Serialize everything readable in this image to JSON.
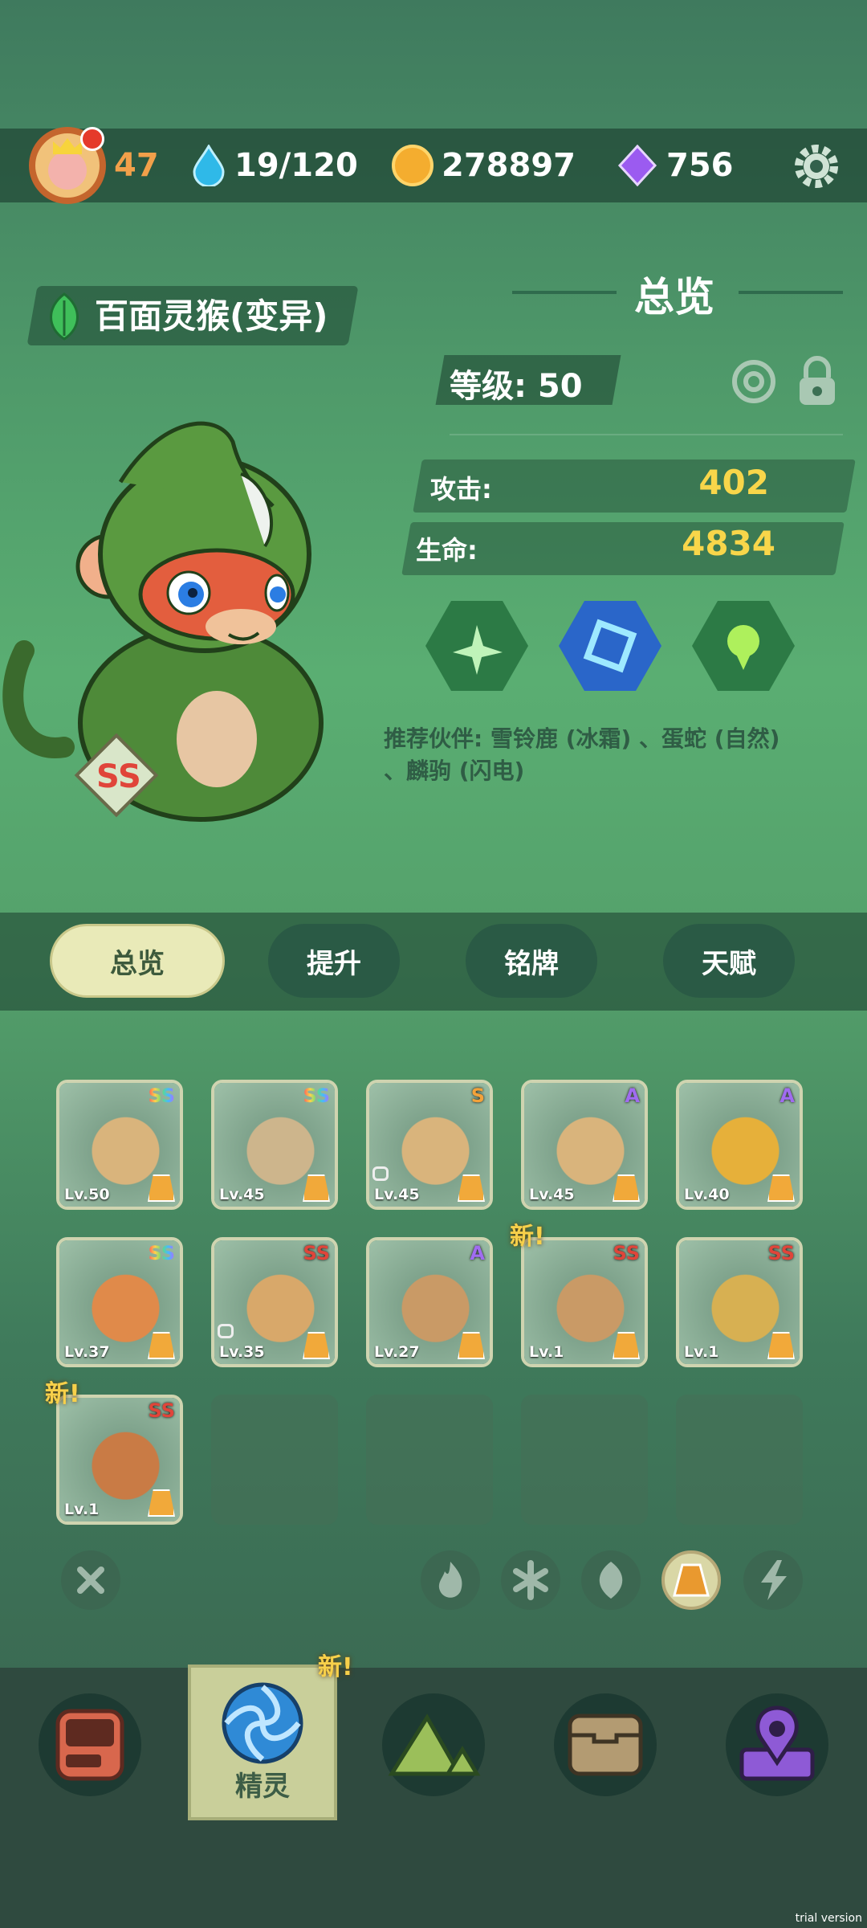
{
  "topbar": {
    "player_level": "47",
    "energy": "19/120",
    "coins": "278897",
    "gems": "756"
  },
  "pet": {
    "name": "百面灵猴(变异)",
    "rank": "SS",
    "level_label": "等级: 50",
    "attack_label": "攻击:",
    "attack_value": "402",
    "hp_label": "生命:",
    "hp_value": "4834",
    "recommend": "推荐伙伴: 雪铃鹿 (冰霜) 、蛋蛇 (自然) 、麟驹 (闪电)"
  },
  "panel_title": "总览",
  "tabs": [
    "总览",
    "提升",
    "铭牌",
    "天赋"
  ],
  "active_tab": 0,
  "roster": [
    {
      "level": "Lv.50",
      "rank": "SS",
      "rank_color": "rainbow",
      "locked": false,
      "new": false,
      "creature": "deer-spirit"
    },
    {
      "level": "Lv.45",
      "rank": "SS",
      "rank_color": "rainbow",
      "locked": false,
      "new": false,
      "creature": "antler-deer"
    },
    {
      "level": "Lv.45",
      "rank": "S",
      "rank_color": "#f3a23a",
      "locked": true,
      "new": false,
      "creature": "deer-spirit"
    },
    {
      "level": "Lv.45",
      "rank": "A",
      "rank_color": "#a06cf0",
      "locked": false,
      "new": false,
      "creature": "deer-spirit"
    },
    {
      "level": "Lv.40",
      "rank": "A",
      "rank_color": "#a06cf0",
      "locked": false,
      "new": false,
      "creature": "sunflower"
    },
    {
      "level": "Lv.37",
      "rank": "SS",
      "rank_color": "rainbow",
      "locked": false,
      "new": false,
      "creature": "phoenix"
    },
    {
      "level": "Lv.35",
      "rank": "SS",
      "rank_color": "#e0453a",
      "locked": true,
      "new": false,
      "creature": "dough-blob"
    },
    {
      "level": "Lv.27",
      "rank": "A",
      "rank_color": "#a06cf0",
      "locked": false,
      "new": false,
      "creature": "potato-sprout"
    },
    {
      "level": "Lv.1",
      "rank": "SS",
      "rank_color": "#e0453a",
      "locked": false,
      "new": true,
      "creature": "potato-sprout"
    },
    {
      "level": "Lv.1",
      "rank": "SS",
      "rank_color": "#e0453a",
      "locked": false,
      "new": false,
      "creature": "skull-beast"
    },
    {
      "level": "Lv.1",
      "rank": "SS",
      "rank_color": "#e0453a",
      "locked": false,
      "new": true,
      "creature": "fox-dog"
    }
  ],
  "new_label": "新!",
  "filters": [
    "clear",
    "fire",
    "ice",
    "nature",
    "earth",
    "lightning"
  ],
  "active_filter": "earth",
  "bottom_nav": {
    "items": [
      "device",
      "spirit",
      "mountain",
      "chest",
      "map"
    ],
    "active_label": "精灵",
    "new_label": "新!"
  },
  "watermark": "trial version"
}
